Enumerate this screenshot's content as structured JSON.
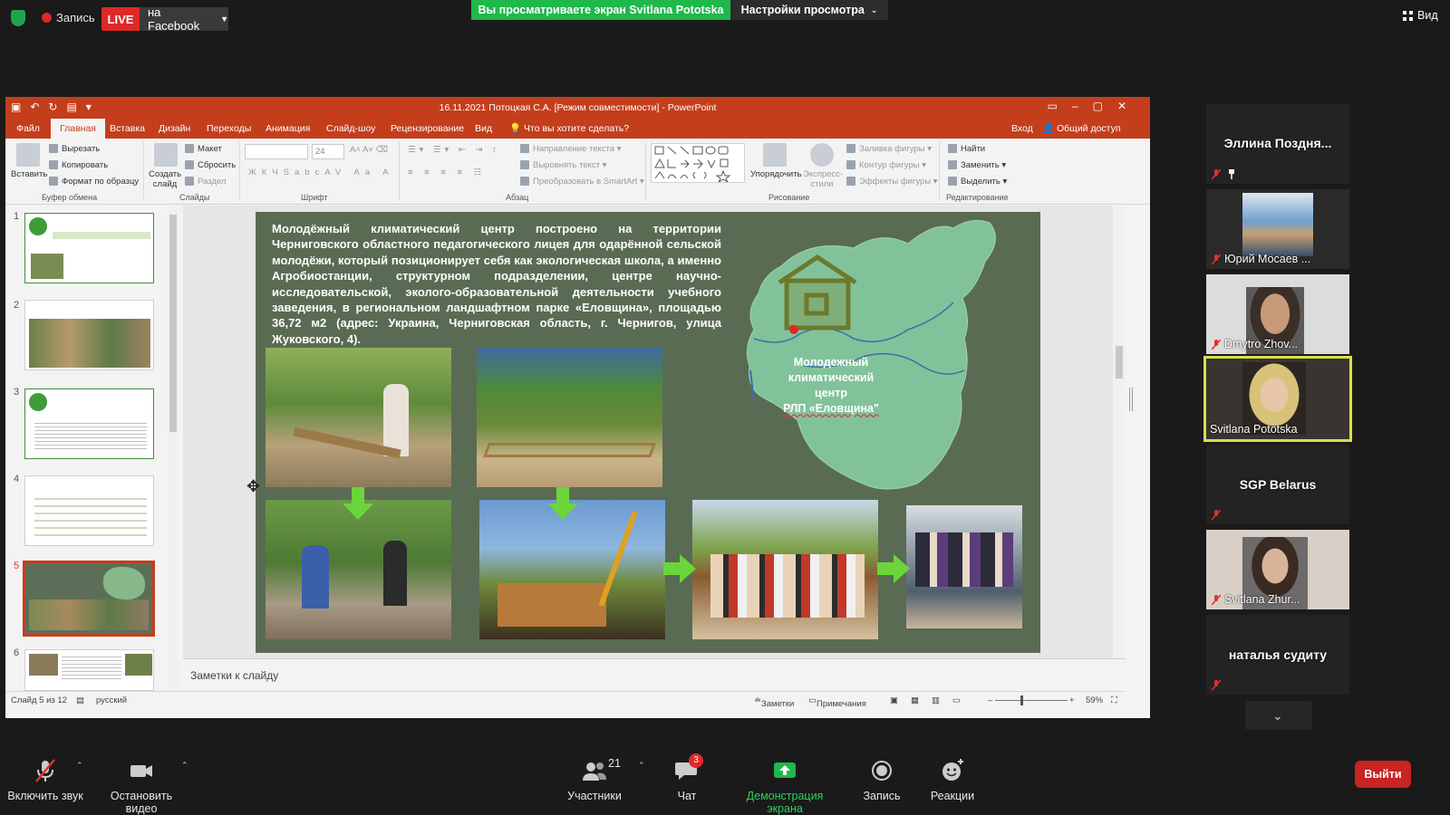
{
  "topbar": {
    "recording_label": "Запись",
    "live_label": "LIVE",
    "live_target": "на Facebook",
    "share_banner": "Вы просматриваете экран Svitlana Pototska",
    "view_options": "Настройки просмотра",
    "view_button": "Вид"
  },
  "powerpoint": {
    "title": "16.11.2021 Потоцкая С.А. [Режим совместимости] - PowerPoint",
    "tabs": [
      "Файл",
      "Главная",
      "Вставка",
      "Дизайн",
      "Переходы",
      "Анимация",
      "Слайд-шоу",
      "Рецензирование",
      "Вид"
    ],
    "tell_me": "Что вы хотите сделать?",
    "signin": "Вход",
    "share": "Общий доступ",
    "ribbon": {
      "paste": "Вставить",
      "cut": "Вырезать",
      "copy": "Копировать",
      "format_painter": "Формат по образцу",
      "clipboard_group": "Буфер обмена",
      "new_slide": "Создать слайд",
      "layout": "Макет",
      "reset": "Сбросить",
      "section": "Раздел",
      "slides_group": "Слайды",
      "font_size": "24",
      "font_group": "Шрифт",
      "text_direction": "Направление текста",
      "align_text": "Выровнять текст",
      "smartart": "Преобразовать в SmartArt",
      "paragraph_group": "Абзац",
      "arrange": "Упорядочить",
      "quick_styles": "Экспресс-стили",
      "shape_fill": "Заливка фигуры",
      "shape_outline": "Контур фигуры",
      "shape_effects": "Эффекты фигуры",
      "drawing_group": "Рисование",
      "find": "Найти",
      "replace": "Заменить",
      "select": "Выделить",
      "editing_group": "Редактирование"
    },
    "thumbnail_numbers": [
      "1",
      "2",
      "3",
      "4",
      "5",
      "6"
    ],
    "slide": {
      "body_text": "Молодёжный климатический центр построено на территории Черниговского областного педагогического лицея для одарённой сельской молодёжи, который позиционирует себя как экологическая школа, а именно Агробиостанции, структурном подразделении, центре научно-исследовательской, эколого-образовательной деятельности учебного заведения, в региональном ландшафтном парке «Еловщина», площадью 36,72 м2 (адрес: Украина, Черниговская область, г. Чернигов, улица Жуковского, 4).",
      "map_label_line1": "Молодежный",
      "map_label_line2": "климатический",
      "map_label_line3": "центр",
      "map_label_line4": "РЛП «Еловщина\""
    },
    "notes_placeholder": "Заметки к слайду",
    "status": {
      "slide_counter": "Слайд 5 из 12",
      "language": "русский",
      "notes": "Заметки",
      "comments": "Примечания",
      "zoom": "59%"
    },
    "colors": {
      "accent": "#c43e1c",
      "slide_bg": "#5a6b54"
    }
  },
  "participants": [
    {
      "name": "Эллина Поздня...",
      "video": false
    },
    {
      "name": "Юрий Мосаев ...",
      "video": true
    },
    {
      "name": "Dmytro Zhov...",
      "video": true
    },
    {
      "name": "Svitlana Pototska",
      "video": true,
      "active": true
    },
    {
      "name": "SGP Belarus",
      "video": false
    },
    {
      "name": "Svitlana Zhur...",
      "video": true
    },
    {
      "name": "наталья судиту",
      "video": false
    }
  ],
  "toolbar": {
    "unmute": "Включить звук",
    "stop_video": "Остановить видео",
    "participants": "Участники",
    "participants_count": "21",
    "chat": "Чат",
    "chat_badge": "3",
    "share_screen": "Демонстрация экрана",
    "record": "Запись",
    "reactions": "Реакции",
    "exit": "Выйти"
  }
}
